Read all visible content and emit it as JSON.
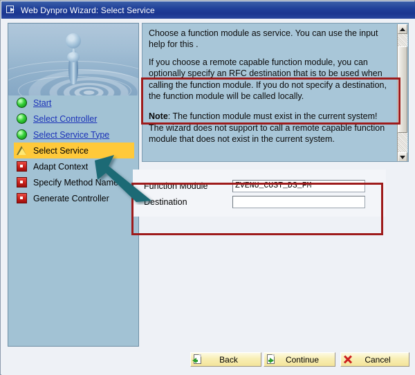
{
  "window": {
    "title": "Web Dynpro Wizard: Select Service",
    "icon": "window-screen-arrow-icon"
  },
  "sidebar": {
    "image_alt": "water-drop-ripple-image",
    "steps": [
      {
        "label": "Start",
        "state": "done",
        "icon": "green-sphere-icon"
      },
      {
        "label": "Select Controller",
        "state": "done",
        "icon": "green-sphere-icon"
      },
      {
        "label": "Select Service Type",
        "state": "done",
        "icon": "green-sphere-icon"
      },
      {
        "label": "Select Service",
        "state": "current",
        "icon": "yellow-warning-triangle-icon"
      },
      {
        "label": "Adapt Context",
        "state": "pending",
        "icon": "red-square-icon"
      },
      {
        "label": "Specify Method Name",
        "state": "pending",
        "icon": "red-square-icon"
      },
      {
        "label": "Generate Controller",
        "state": "pending",
        "icon": "red-square-icon"
      }
    ]
  },
  "instructions": {
    "paragraph1": "Choose a function module as service. You can use the input help for this .",
    "paragraph2": "If you choose a remote capable function module, you can optionally specify an RFC destination that is to be used when calling the function module. If you do not specify a destination, the function module will be called locally.",
    "note_label": "Note",
    "note_text": ": The function module must exist in the current system! The wizard does not support to call a remote capable function module that does not exist in the current system."
  },
  "form": {
    "function_module": {
      "label": "Function Module",
      "value": "ZVENU_CUST_DS_FM",
      "placeholder": ""
    },
    "destination": {
      "label": "Destination",
      "value": "",
      "placeholder": ""
    }
  },
  "footer": {
    "back_label": "Back",
    "continue_label": "Continue",
    "cancel_label": "Cancel"
  },
  "colors": {
    "titlebar": "#21419a",
    "panel_blue": "#a8c6d8",
    "highlight_yellow": "#ffc93a",
    "annotation_red": "#9e1b1b",
    "button_yellow": "#f8eeb4",
    "link_blue": "#1b32b8"
  }
}
